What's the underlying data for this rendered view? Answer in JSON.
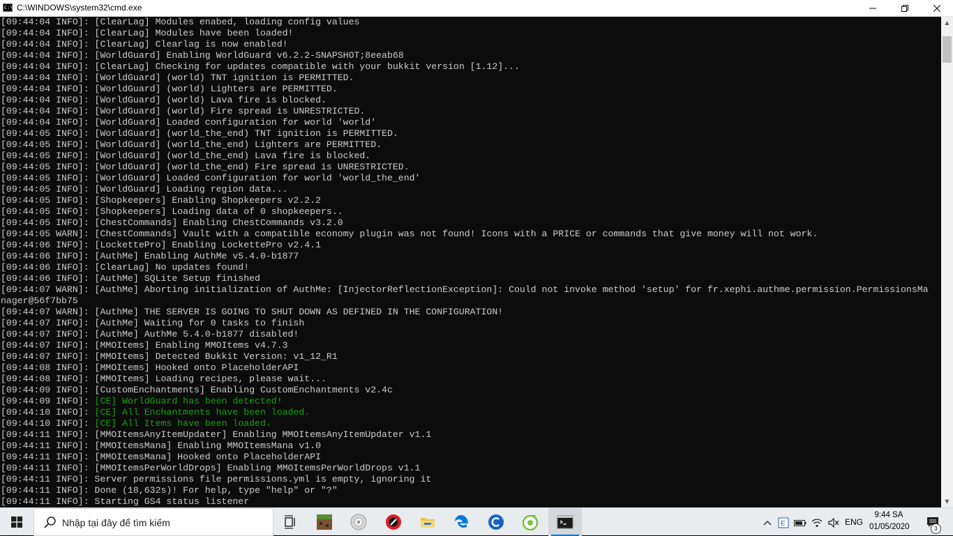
{
  "window": {
    "title": "C:\\WINDOWS\\system32\\cmd.exe",
    "icon_text": "C:\\"
  },
  "console": {
    "lines": [
      {
        "text": "[09:44:04 INFO]: [ClearLag] Modules enabed, loading config values"
      },
      {
        "text": "[09:44:04 INFO]: [ClearLag] Modules have been loaded!"
      },
      {
        "text": "[09:44:04 INFO]: [ClearLag] Clearlag is now enabled!"
      },
      {
        "text": "[09:44:04 INFO]: [WorldGuard] Enabling WorldGuard v6.2.2-SNAPSHOT;8eeab68"
      },
      {
        "text": "[09:44:04 INFO]: [ClearLag] Checking for updates compatible with your bukkit version [1.12]..."
      },
      {
        "text": "[09:44:04 INFO]: [WorldGuard] (world) TNT ignition is PERMITTED."
      },
      {
        "text": "[09:44:04 INFO]: [WorldGuard] (world) Lighters are PERMITTED."
      },
      {
        "text": "[09:44:04 INFO]: [WorldGuard] (world) Lava fire is blocked."
      },
      {
        "text": "[09:44:04 INFO]: [WorldGuard] (world) Fire spread is UNRESTRICTED."
      },
      {
        "text": "[09:44:04 INFO]: [WorldGuard] Loaded configuration for world 'world'"
      },
      {
        "text": "[09:44:05 INFO]: [WorldGuard] (world_the_end) TNT ignition is PERMITTED."
      },
      {
        "text": "[09:44:05 INFO]: [WorldGuard] (world_the_end) Lighters are PERMITTED."
      },
      {
        "text": "[09:44:05 INFO]: [WorldGuard] (world_the_end) Lava fire is blocked."
      },
      {
        "text": "[09:44:05 INFO]: [WorldGuard] (world_the_end) Fire spread is UNRESTRICTED."
      },
      {
        "text": "[09:44:05 INFO]: [WorldGuard] Loaded configuration for world 'world_the_end'"
      },
      {
        "text": "[09:44:05 INFO]: [WorldGuard] Loading region data..."
      },
      {
        "text": "[09:44:05 INFO]: [Shopkeepers] Enabling Shopkeepers v2.2.2"
      },
      {
        "text": "[09:44:05 INFO]: [Shopkeepers] Loading data of 0 shopkeepers.."
      },
      {
        "text": "[09:44:05 INFO]: [ChestCommands] Enabling ChestCommands v3.2.0"
      },
      {
        "text": "[09:44:05 WARN]: [ChestCommands] Vault with a compatible economy plugin was not found! Icons with a PRICE or commands that give money will not work."
      },
      {
        "text": "[09:44:06 INFO]: [LockettePro] Enabling LockettePro v2.4.1"
      },
      {
        "text": "[09:44:06 INFO]: [AuthMe] Enabling AuthMe v5.4.0-b1877"
      },
      {
        "text": "[09:44:06 INFO]: [ClearLag] No updates found!"
      },
      {
        "text": "[09:44:06 INFO]: [AuthMe] SQLite Setup finished"
      },
      {
        "text": "[09:44:07 WARN]: [AuthMe] Aborting initialization of AuthMe: [InjectorReflectionException]: Could not invoke method 'setup' for fr.xephi.authme.permission.PermissionsMa"
      },
      {
        "text": "nager@56f7bb75"
      },
      {
        "text": "[09:44:07 WARN]: [AuthMe] THE SERVER IS GOING TO SHUT DOWN AS DEFINED IN THE CONFIGURATION!"
      },
      {
        "text": "[09:44:07 INFO]: [AuthMe] Waiting for 0 tasks to finish"
      },
      {
        "text": "[09:44:07 INFO]: [AuthMe] AuthMe 5.4.0-b1877 disabled!"
      },
      {
        "text": "[09:44:07 INFO]: [MMOItems] Enabling MMOItems v4.7.3"
      },
      {
        "text": "[09:44:07 INFO]: [MMOItems] Detected Bukkit Version: v1_12_R1"
      },
      {
        "text": "[09:44:08 INFO]: [MMOItems] Hooked onto PlaceholderAPI"
      },
      {
        "text": "[09:44:08 INFO]: [MMOItems] Loading recipes, please wait..."
      },
      {
        "text": "[09:44:09 INFO]: [CustomEnchantments] Enabling CustomEnchantments v2.4c"
      },
      {
        "text": "[09:44:09 INFO]: ",
        "green": "[CE] WorldGuard has been detected!"
      },
      {
        "text": "[09:44:10 INFO]: ",
        "green": "[CE] All Enchantments have been loaded."
      },
      {
        "text": "[09:44:10 INFO]: ",
        "green": "[CE] All Items have been loaded."
      },
      {
        "text": "[09:44:11 INFO]: [MMOItemsAnyItemUpdater] Enabling MMOItemsAnyItemUpdater v1.1"
      },
      {
        "text": "[09:44:11 INFO]: [MMOItemsMana] Enabling MMOItemsMana v1.0"
      },
      {
        "text": "[09:44:11 INFO]: [MMOItemsMana] Hooked onto PlaceholderAPI"
      },
      {
        "text": "[09:44:11 INFO]: [MMOItemsPerWorldDrops] Enabling MMOItemsPerWorldDrops v1.1"
      },
      {
        "text": "[09:44:11 INFO]: Server permissions file permissions.yml is empty, ignoring it"
      },
      {
        "text": "[09:44:11 INFO]: Done (18,632s)! For help, type \"help\" or \"?\""
      },
      {
        "text": "[09:44:11 INFO]: Starting GS4 status listener"
      }
    ]
  },
  "taskbar": {
    "search_placeholder": "Nhập tại đây để tìm kiếm",
    "apps": [
      "task-view-icon",
      "minecraft-icon",
      "media-player-icon",
      "red-app-icon",
      "file-explorer-icon",
      "edge-icon",
      "ccleaner-icon",
      "coccoc-icon",
      "cmd-icon"
    ],
    "tray": {
      "language": "ENG",
      "time": "9:44 SA",
      "date": "01/05/2020",
      "notification_count": "3"
    }
  },
  "colors": {
    "console_bg": "#0c0c0c",
    "console_text": "#cccccc",
    "console_green": "#13a10e",
    "accent": "#0078d7"
  }
}
